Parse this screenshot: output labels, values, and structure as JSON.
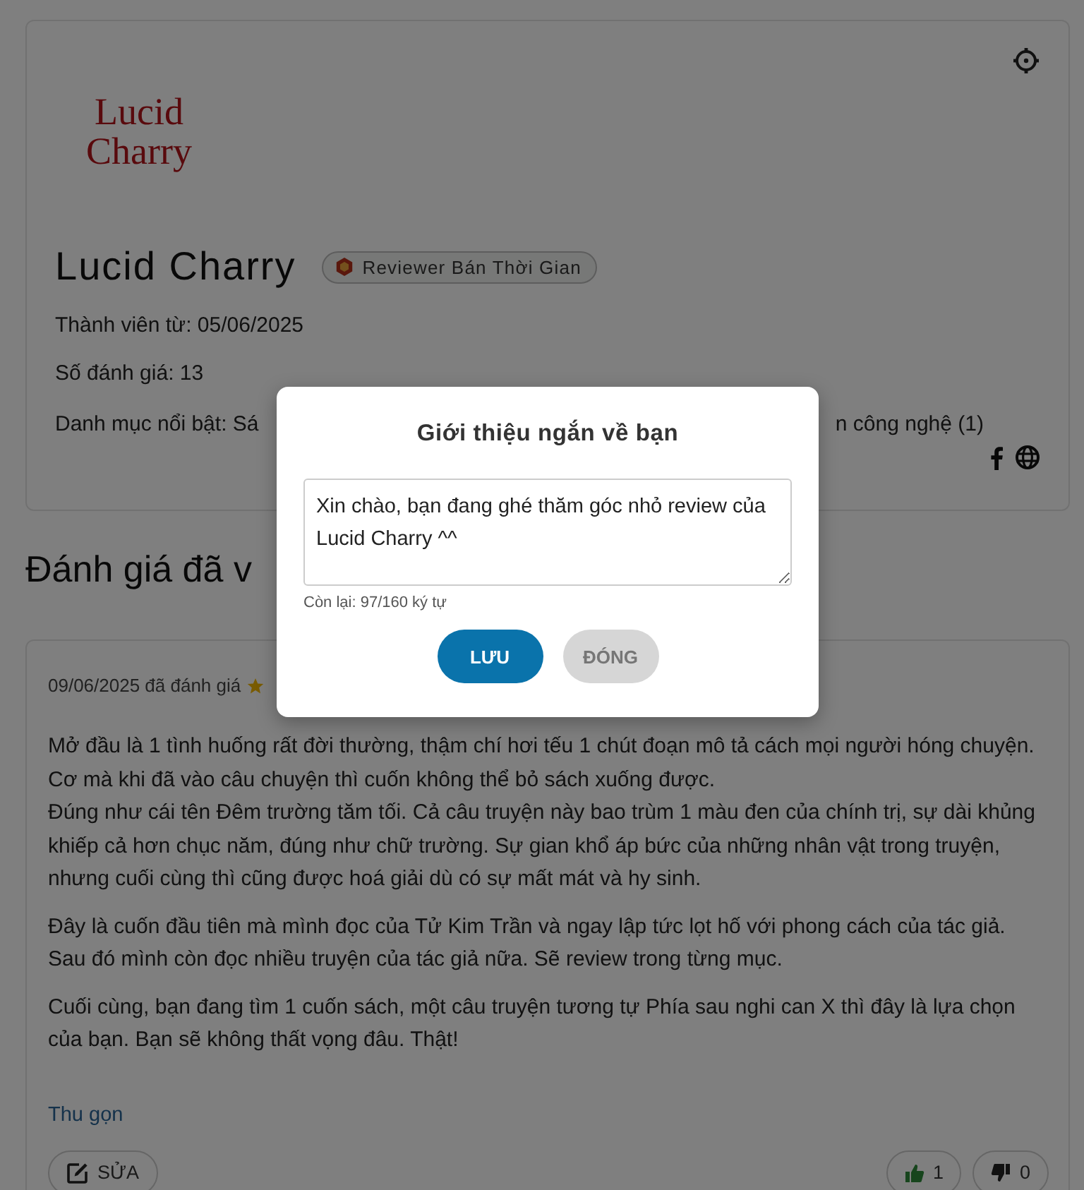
{
  "profile": {
    "logo_line_1": "Lucid",
    "logo_line_2": "Charry",
    "name": "Lucid Charry",
    "badge": "Reviewer Bán Thời Gian",
    "member_since": "Thành viên từ: 05/06/2025",
    "review_count": "Số đánh giá: 13",
    "categories_left": "Danh mục nổi bật: Sá",
    "categories_right": "n công nghệ (1)"
  },
  "section_heading": "Đánh giá đã v",
  "review": {
    "date": "09/06/2025 đã đánh giá",
    "paragraphs": [
      "Mở đầu là 1 tình huống rất đời thường, thậm chí hơi tếu 1 chút đoạn mô tả cách mọi người hóng chuyện. Cơ mà khi đã vào câu chuyện thì cuốn không thể bỏ sách xuống được.\nĐúng như cái tên Đêm trường tăm tối. Cả câu truyện này bao trùm 1 màu đen của chính trị, sự dài khủng khiếp cả hơn chục năm, đúng như chữ trường. Sự gian khổ áp bức của những nhân vật trong truyện, nhưng cuối cùng thì cũng được hoá giải dù có sự mất mát và hy sinh.",
      "Đây là cuốn đầu tiên mà mình đọc của Tử Kim Trần và ngay lập tức lọt hố với phong cách của tác giả. Sau đó mình còn đọc nhiều truyện của tác giả nữa. Sẽ review trong từng mục.",
      "Cuối cùng, bạn đang tìm 1 cuốn sách, một câu truyện tương tự Phía sau nghi can X thì đây là lựa chọn của bạn. Bạn sẽ không thất vọng đâu. Thật!"
    ],
    "collapse_link": "Thu gọn",
    "edit_button": "SỬA",
    "likes": "1",
    "dislikes": "0"
  },
  "modal": {
    "title": "Giới thiệu ngắn về bạn",
    "value": "Xin chào, bạn đang ghé thăm góc nhỏ review của Lucid Charry ^^",
    "counter": "Còn lại: 97/160 ký tự",
    "save_button": "LƯU",
    "close_button": {
      "label": "ĐÓNG",
      "disabled": true
    }
  }
}
